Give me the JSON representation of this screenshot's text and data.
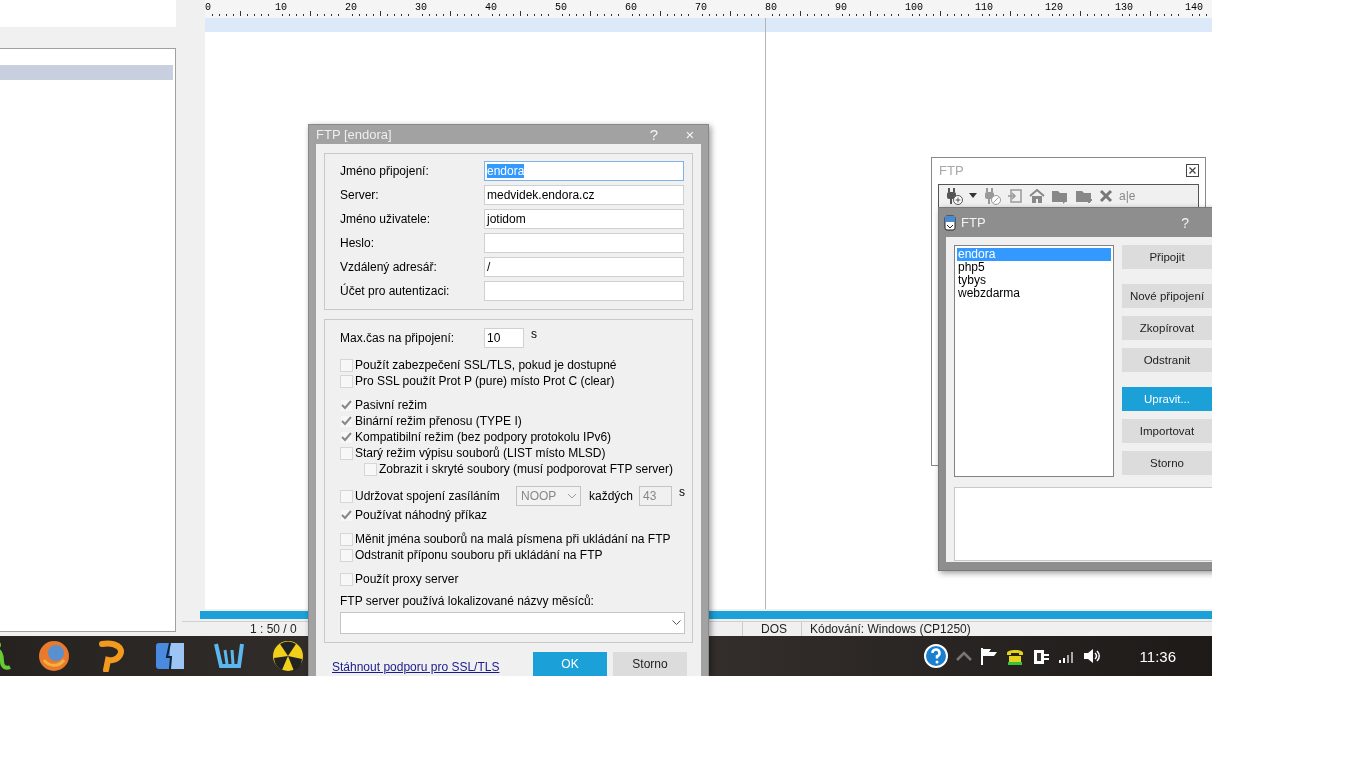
{
  "editor": {
    "ruler_labels": [
      "0",
      "10",
      "20",
      "30",
      "40",
      "50",
      "60",
      "70",
      "80",
      "90",
      "100",
      "110",
      "120",
      "130",
      "140"
    ],
    "status_bar": {
      "position": "1 : 50 / 0",
      "line_ending": "DOS",
      "encoding": "Kódování: Windows (CP1250)"
    }
  },
  "connection_dialog": {
    "title": "FTP  [endora]",
    "help": "?",
    "close": "×",
    "fields": [
      {
        "label": "Jméno připojení:",
        "value": "endora",
        "focused": true
      },
      {
        "label": "Server:",
        "value": "medvidek.endora.cz",
        "focused": false
      },
      {
        "label": "Jméno uživatele:",
        "value": "jotidom",
        "focused": false
      },
      {
        "label": "Heslo:",
        "focused": false
      },
      {
        "label": "Vzdálený adresář:",
        "value": "/",
        "focused": false
      },
      {
        "label": "Účet pro autentizaci:",
        "focused": false
      }
    ],
    "timeout": {
      "label": "Max.čas na připojení:",
      "value": "10",
      "unit": "s"
    },
    "option_groups": [
      [
        {
          "kind": "checkbox",
          "label": "Použít zabezpečení SSL/TLS, pokud je dostupné",
          "checked": false
        },
        {
          "kind": "checkbox",
          "label": "Pro SSL použít Prot P (pure) místo Prot C (clear)",
          "checked": false
        }
      ],
      [
        {
          "kind": "checkbox",
          "label": "Pasivní režim",
          "checked": true
        },
        {
          "kind": "checkbox",
          "label": "Binární režim přenosu (TYPE I)",
          "checked": true
        },
        {
          "kind": "checkbox",
          "label": "Kompatibilní režim (bez podpory protokolu IPv6)",
          "checked": true
        },
        {
          "kind": "checkbox",
          "label": "Starý režim výpisu souborů (LIST místo MLSD)",
          "checked": false,
          "children": [
            {
              "kind": "checkbox",
              "label": "Zobrazit i skryté soubory (musí podporovat FTP server)",
              "checked": false
            }
          ]
        }
      ],
      [
        {
          "kind": "keepalive",
          "label": "Udržovat spojení zasíláním",
          "checked": false,
          "command": "NOOP",
          "every_label": "každých",
          "interval": "43",
          "unit": "s",
          "disabled": true
        },
        {
          "kind": "checkbox",
          "label": "Používat náhodný příkaz",
          "checked": true
        }
      ],
      [
        {
          "kind": "checkbox",
          "label": "Měnit jména souborů na malá písmena při ukládání na FTP",
          "checked": false
        },
        {
          "kind": "checkbox",
          "label": "Odstranit příponu souboru při ukládání na FTP",
          "checked": false
        }
      ],
      [
        {
          "kind": "checkbox",
          "label": "Použít proxy server",
          "checked": false
        }
      ]
    ],
    "month_names": {
      "label": "FTP server používá lokalizované názvy měsíců:"
    },
    "link": "Stáhnout podporu pro SSL/TLS",
    "buttons": [
      {
        "label": "OK",
        "default": true
      },
      {
        "label": "Storno",
        "default": false
      }
    ]
  },
  "ftp_panel": {
    "title": "FTP",
    "toolbar_text": "a|e"
  },
  "connections_dialog": {
    "title": "FTP",
    "help": "?",
    "connections": [
      {
        "name": "endora",
        "selected": true
      },
      {
        "name": "php5",
        "selected": false
      },
      {
        "name": "tybys",
        "selected": false
      },
      {
        "name": "webzdarma",
        "selected": false
      }
    ],
    "button_groups": [
      [
        {
          "label": "Připojit",
          "default": false
        }
      ],
      [
        {
          "label": "Nové připojení",
          "default": false
        },
        {
          "label": "Zkopírovat",
          "default": false
        },
        {
          "label": "Odstranit",
          "default": false
        }
      ],
      [
        {
          "label": "Upravit...",
          "default": true
        },
        {
          "label": "Importovat",
          "default": false
        },
        {
          "label": "Storno",
          "default": false
        }
      ]
    ]
  },
  "taskbar": {
    "time": "11:36"
  }
}
